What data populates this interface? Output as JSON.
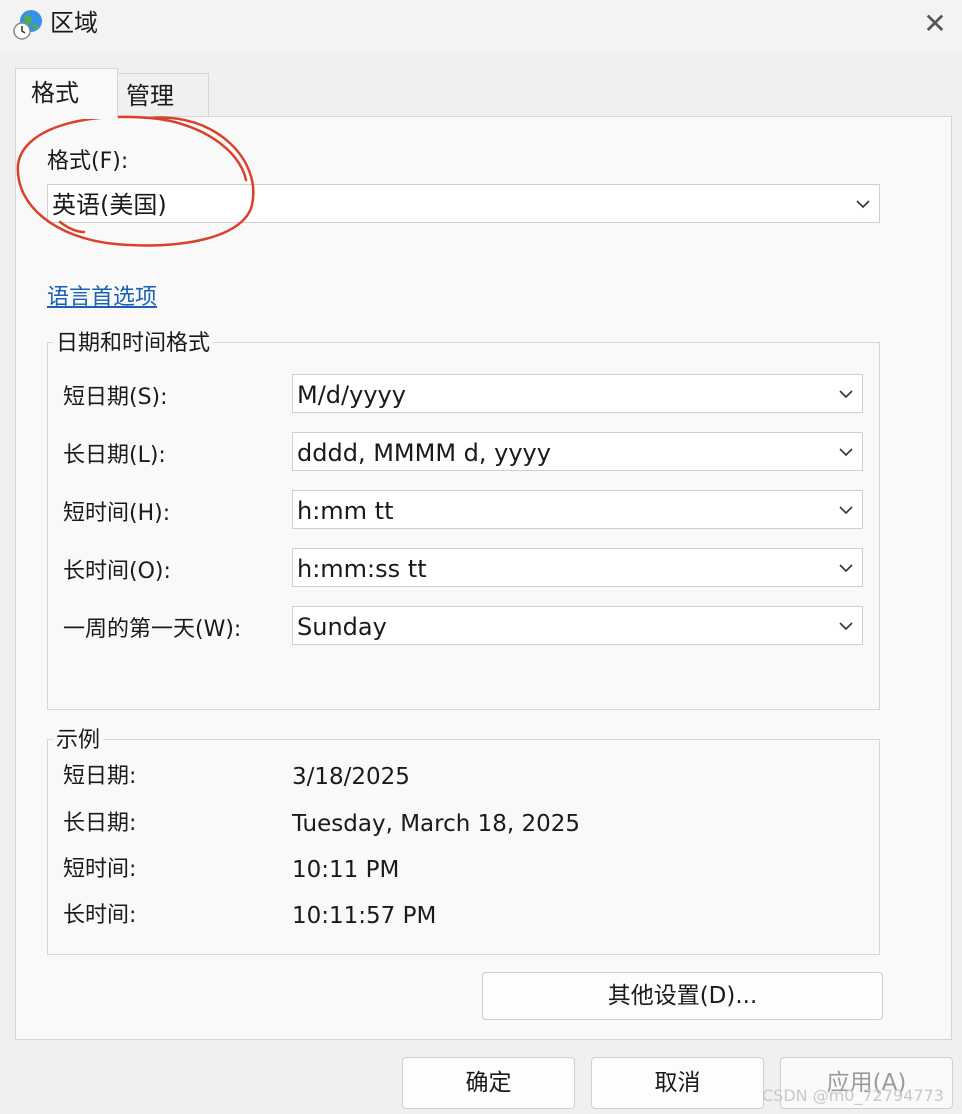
{
  "window": {
    "title": "区域",
    "close_label": "✕"
  },
  "tabs": [
    {
      "label": "格式",
      "active": true
    },
    {
      "label": "管理",
      "active": false
    }
  ],
  "format": {
    "label": "格式(F):",
    "value": "英语(美国)"
  },
  "language_link": "语言首选项",
  "datetime_group": {
    "legend": "日期和时间格式",
    "rows": [
      {
        "label": "短日期(S):",
        "value": "M/d/yyyy"
      },
      {
        "label": "长日期(L):",
        "value": "dddd, MMMM d, yyyy"
      },
      {
        "label": "短时间(H):",
        "value": "h:mm tt"
      },
      {
        "label": "长时间(O):",
        "value": "h:mm:ss tt"
      },
      {
        "label": "一周的第一天(W):",
        "value": "Sunday"
      }
    ]
  },
  "examples": {
    "legend": "示例",
    "rows": [
      {
        "label": "短日期:",
        "value": "3/18/2025"
      },
      {
        "label": "长日期:",
        "value": "Tuesday, March 18, 2025"
      },
      {
        "label": "短时间:",
        "value": "10:11 PM"
      },
      {
        "label": "长时间:",
        "value": "10:11:57 PM"
      }
    ]
  },
  "buttons": {
    "additional": "其他设置(D)...",
    "ok": "确定",
    "cancel": "取消",
    "apply": "应用(A)"
  },
  "watermark": "CSDN @m0_72794773",
  "colors": {
    "annotation": "#d9412b",
    "link": "#1a5fb4"
  },
  "icons": {
    "app": "globe-clock-icon",
    "dropdown": "chevron-down-icon"
  }
}
